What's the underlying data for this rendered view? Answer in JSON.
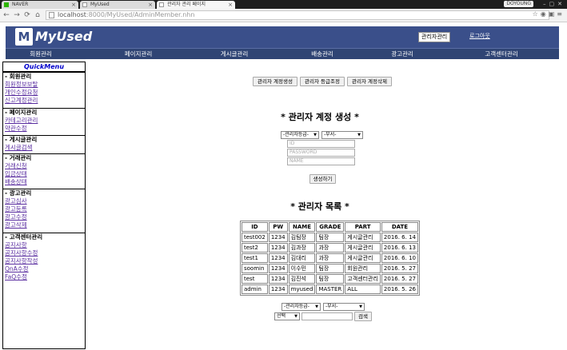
{
  "browser": {
    "tabs": [
      {
        "title": "NAVER",
        "favicon": "naver-icon"
      },
      {
        "title": "MyUsed",
        "favicon": "page-icon"
      },
      {
        "title": "관리자 관리 페이지",
        "favicon": "page-icon"
      }
    ],
    "user_badge": "DOYOUNG",
    "url_host": "localhost",
    "url_path": ":8000/MyUsed/AdminMember.nhn"
  },
  "header": {
    "logo_text": "MyUsed",
    "admin_button": "관리자관리",
    "logout_link": "로그아웃"
  },
  "nav": [
    "회원관리",
    "페이지관리",
    "게시글관리",
    "배송관리",
    "광고관리",
    "고객센터관리"
  ],
  "quickmenu": {
    "title": "QuickMenu",
    "groups": [
      {
        "head": "- 회원관리",
        "links": [
          "회원정보보탈",
          "개인수정요청",
          "신고계정관리"
        ]
      },
      {
        "head": "- 페이지관리",
        "links": [
          "카테고리관리",
          "약관수정"
        ]
      },
      {
        "head": "- 게시글관리",
        "links": [
          "게시글검색"
        ]
      },
      {
        "head": "- 거래관리",
        "links": [
          "거래신청",
          "입금상태",
          "배송상태"
        ]
      },
      {
        "head": "- 광고관리",
        "links": [
          "광고심사",
          "광고등록",
          "광고수정",
          "광고삭제"
        ]
      },
      {
        "head": "- 고객센터관리",
        "links": [
          "공지사항",
          "공지사항수정",
          "공지사항작성",
          "QnA수정",
          "FaQ수정"
        ]
      }
    ]
  },
  "actions": {
    "create": "관리자 계정생성",
    "grade": "관리자 등급조정",
    "delete": "관리자 계정삭제"
  },
  "create_form": {
    "title": "* 관리자 계정 생성 *",
    "grade_select": "-관리자등급-",
    "dept_select": "-부서-",
    "id_placeholder": "ID",
    "password_placeholder": "PASSWORD",
    "name_placeholder": "NAME",
    "submit": "생성하기"
  },
  "admin_list": {
    "title": "* 관리자 목록 *",
    "columns": [
      "ID",
      "PW",
      "NAME",
      "GRADE",
      "PART",
      "DATE"
    ],
    "rows": [
      [
        "test002",
        "1234",
        "김팀장",
        "팀장",
        "게시글관리",
        "2016. 6. 14"
      ],
      [
        "test2",
        "1234",
        "김과장",
        "과장",
        "게시글관리",
        "2016. 6. 13"
      ],
      [
        "test1",
        "1234",
        "김대리",
        "과장",
        "게시글관리",
        "2016. 6. 10"
      ],
      [
        "soomin",
        "1234",
        "이수민",
        "팀장",
        "회원관리",
        "2016. 5. 27"
      ],
      [
        "test",
        "1234",
        "김진석",
        "팀장",
        "고객센터관리",
        "2016. 5. 27"
      ],
      [
        "admin",
        "1234",
        "myused",
        "MASTER",
        "ALL",
        "2016. 5. 26"
      ]
    ]
  },
  "search": {
    "grade_select": "-관리자등급-",
    "dept_select": "-부서-",
    "type_select": "선택",
    "button": "검색"
  }
}
